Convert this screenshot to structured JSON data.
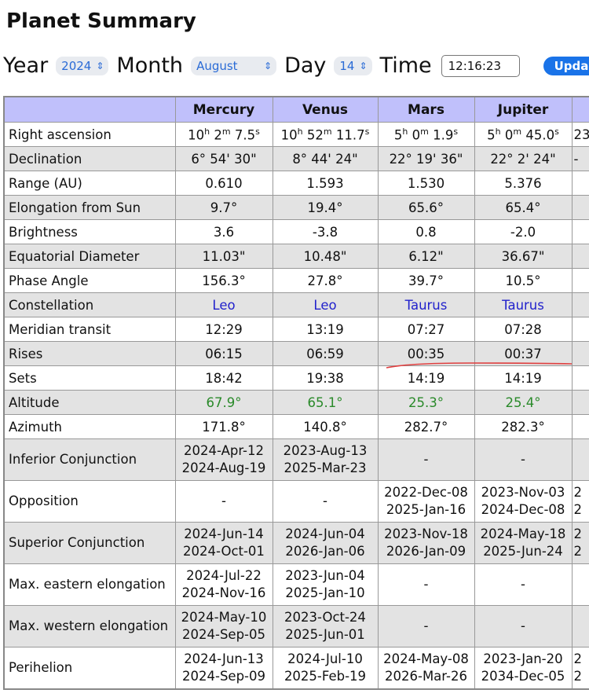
{
  "title": "Planet Summary",
  "controls": {
    "year_label": "Year",
    "year_value": "2024",
    "month_label": "Month",
    "month_value": "August",
    "day_label": "Day",
    "day_value": "14",
    "time_label": "Time",
    "time_value": "12:16:23",
    "update_label": "Upda"
  },
  "colors": {
    "header_bg": "#c0c0fb",
    "constellation": "#2222cc",
    "altitude": "#2a8a2a",
    "annotation": "#e04040"
  },
  "table": {
    "columns": [
      "",
      "Mercury",
      "Venus",
      "Mars",
      "Jupiter",
      ""
    ],
    "rows": [
      {
        "label": "Right ascension",
        "type": "ra",
        "values": [
          [
            "10",
            "2",
            "7.5"
          ],
          [
            "10",
            "52",
            "11.7"
          ],
          [
            "5",
            "0",
            "1.9"
          ],
          [
            "5",
            "0",
            "45.0"
          ]
        ],
        "clipped": "23"
      },
      {
        "label": "Declination",
        "values": [
          "6° 54' 30\"",
          "8° 44' 24\"",
          "22° 19' 36\"",
          "22° 2' 24\""
        ],
        "clipped": "-"
      },
      {
        "label": "Range (AU)",
        "values": [
          "0.610",
          "1.593",
          "1.530",
          "5.376"
        ]
      },
      {
        "label": "Elongation from Sun",
        "values": [
          "9.7°",
          "19.4°",
          "65.6°",
          "65.4°"
        ]
      },
      {
        "label": "Brightness",
        "values": [
          "3.6",
          "-3.8",
          "0.8",
          "-2.0"
        ]
      },
      {
        "label": "Equatorial Diameter",
        "values": [
          "11.03\"",
          "10.48\"",
          "6.12\"",
          "36.67\""
        ]
      },
      {
        "label": "Phase Angle",
        "values": [
          "156.3°",
          "27.8°",
          "39.7°",
          "10.5°"
        ]
      },
      {
        "label": "Constellation",
        "style": "blue",
        "values": [
          "Leo",
          "Leo",
          "Taurus",
          "Taurus"
        ]
      },
      {
        "label": "Meridian transit",
        "values": [
          "12:29",
          "13:19",
          "07:27",
          "07:28"
        ]
      },
      {
        "label": "Rises",
        "values": [
          "06:15",
          "06:59",
          "00:35",
          "00:37"
        ]
      },
      {
        "label": "Sets",
        "values": [
          "18:42",
          "19:38",
          "14:19",
          "14:19"
        ]
      },
      {
        "label": "Altitude",
        "style": "green",
        "values": [
          "67.9°",
          "65.1°",
          "25.3°",
          "25.4°"
        ]
      },
      {
        "label": "Azimuth",
        "values": [
          "171.8°",
          "140.8°",
          "282.7°",
          "282.3°"
        ]
      },
      {
        "label": "Inferior Conjunction",
        "tall": true,
        "values": [
          [
            "2024-Apr-12",
            "2024-Aug-19"
          ],
          [
            "2023-Aug-13",
            "2025-Mar-23"
          ],
          [
            "-"
          ],
          [
            "-"
          ]
        ]
      },
      {
        "label": "Opposition",
        "tall": true,
        "values": [
          [
            "-"
          ],
          [
            "-"
          ],
          [
            "2022-Dec-08",
            "2025-Jan-16"
          ],
          [
            "2023-Nov-03",
            "2024-Dec-08"
          ]
        ],
        "clipped": [
          "2",
          "2"
        ]
      },
      {
        "label": "Superior Conjunction",
        "tall": true,
        "values": [
          [
            "2024-Jun-14",
            "2024-Oct-01"
          ],
          [
            "2024-Jun-04",
            "2026-Jan-06"
          ],
          [
            "2023-Nov-18",
            "2026-Jan-09"
          ],
          [
            "2024-May-18",
            "2025-Jun-24"
          ]
        ],
        "clipped": [
          "2",
          "2"
        ]
      },
      {
        "label": "Max. eastern elongation",
        "tall": true,
        "values": [
          [
            "2024-Jul-22",
            "2024-Nov-16"
          ],
          [
            "2023-Jun-04",
            "2025-Jan-10"
          ],
          [
            "-"
          ],
          [
            "-"
          ]
        ]
      },
      {
        "label": "Max. western elongation",
        "tall": true,
        "values": [
          [
            "2024-May-10",
            "2024-Sep-05"
          ],
          [
            "2023-Oct-24",
            "2025-Jun-01"
          ],
          [
            "-"
          ],
          [
            "-"
          ]
        ]
      },
      {
        "label": "Perihelion",
        "tall": true,
        "values": [
          [
            "2024-Jun-13",
            "2024-Sep-09"
          ],
          [
            "2024-Jul-10",
            "2025-Feb-19"
          ],
          [
            "2024-May-08",
            "2026-Mar-26"
          ],
          [
            "2023-Jan-20",
            "2034-Dec-05"
          ]
        ],
        "clipped": [
          "2",
          "2"
        ]
      }
    ]
  }
}
